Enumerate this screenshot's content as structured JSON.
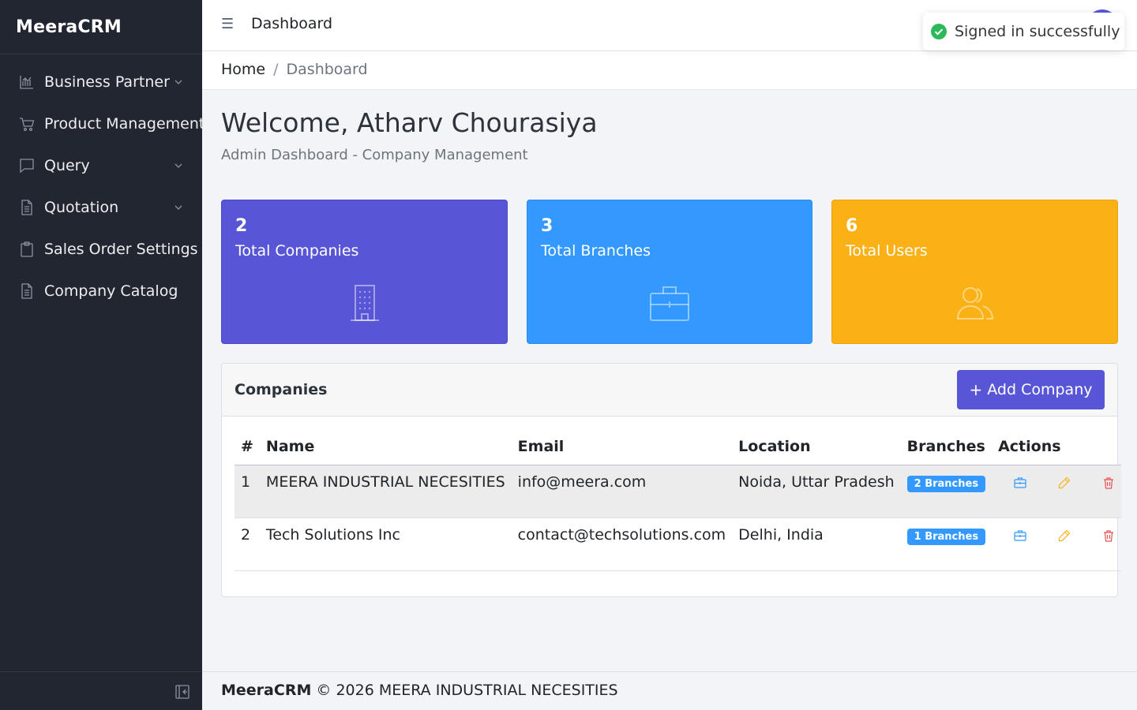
{
  "app": {
    "brand": "MeeraCRM"
  },
  "sidebar": {
    "items": [
      {
        "label": "Business Partner",
        "icon": "chart-icon",
        "has_chevron": true
      },
      {
        "label": "Product Management",
        "icon": "cart-icon",
        "has_chevron": false
      },
      {
        "label": "Query",
        "icon": "chat-icon",
        "has_chevron": true
      },
      {
        "label": "Quotation",
        "icon": "document-icon",
        "has_chevron": true
      },
      {
        "label": "Sales Order Settings",
        "icon": "clipboard-icon",
        "has_chevron": false
      },
      {
        "label": "Company Catalog",
        "icon": "document-icon",
        "has_chevron": false
      }
    ]
  },
  "header": {
    "title": "Dashboard"
  },
  "breadcrumb": {
    "home": "Home",
    "separator": "/",
    "current": "Dashboard"
  },
  "main": {
    "welcome": "Welcome, Atharv Chourasiya",
    "subtitle": "Admin Dashboard - Company Management"
  },
  "stats": [
    {
      "value": "2",
      "label": "Total Companies",
      "color": "#5856d6",
      "icon": "building-icon"
    },
    {
      "value": "3",
      "label": "Total Branches",
      "color": "#3399ff",
      "icon": "briefcase-icon"
    },
    {
      "value": "6",
      "label": "Total Users",
      "color": "#f9b115",
      "icon": "users-icon"
    }
  ],
  "companies": {
    "title": "Companies",
    "add_button": "Add Company",
    "add_icon": "+",
    "columns": [
      "#",
      "Name",
      "Email",
      "Location",
      "Branches",
      "Actions"
    ],
    "rows": [
      {
        "num": "1",
        "name": "MEERA INDUSTRIAL NECESITIES",
        "email": "info@meera.com",
        "location": "Noida, Uttar Pradesh",
        "branches": "2 Branches"
      },
      {
        "num": "2",
        "name": "Tech Solutions Inc",
        "email": "contact@techsolutions.com",
        "location": "Delhi, India",
        "branches": "1 Branches"
      }
    ]
  },
  "footer": {
    "brand": "MeeraCRM",
    "text": "© 2026 MEERA INDUSTRIAL NECESITIES"
  },
  "toast": {
    "message": "Signed in successfully",
    "color": "#2eb85c"
  }
}
